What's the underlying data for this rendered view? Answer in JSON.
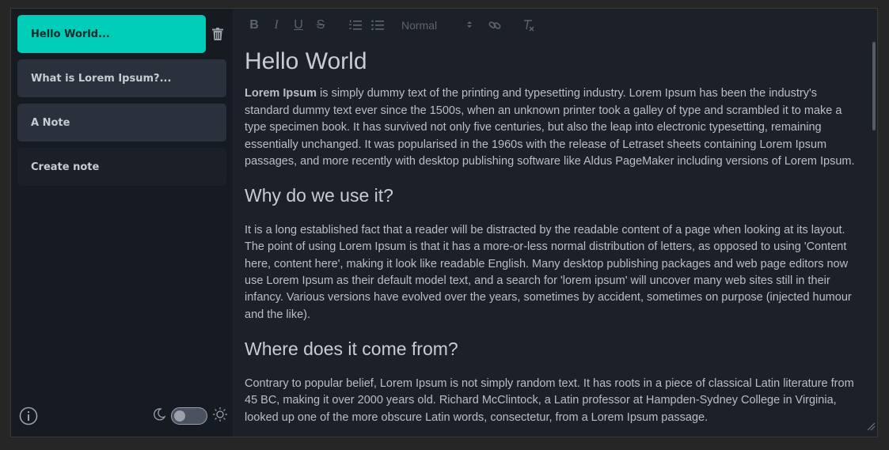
{
  "sidebar": {
    "notes": [
      {
        "label": "Hello World..."
      },
      {
        "label": "What is Lorem Ipsum?..."
      },
      {
        "label": "A Note"
      }
    ],
    "create_label": "Create note"
  },
  "toolbar": {
    "heading_value": "Normal",
    "heading_options": [
      "Normal"
    ]
  },
  "document": {
    "title": "Hello World",
    "p1_bold": "Lorem Ipsum",
    "p1_rest": " is simply dummy text of the printing and typesetting industry. Lorem Ipsum has been the industry's standard dummy text ever since the 1500s, when an unknown printer took a galley of type and scrambled it to make a type specimen book. It has survived not only five centuries, but also the leap into electronic typesetting, remaining essentially unchanged. It was popularised in the 1960s with the release of Letraset sheets containing Lorem Ipsum passages, and more recently with desktop publishing software like Aldus PageMaker including versions of Lorem Ipsum.",
    "h2_why": "Why do we use it?",
    "p_why": "It is a long established fact that a reader will be distracted by the readable content of a page when looking at its layout. The point of using Lorem Ipsum is that it has a more-or-less normal distribution of letters, as opposed to using 'Content here, content here', making it look like readable English. Many desktop publishing packages and web page editors now use Lorem Ipsum as their default model text, and a search for 'lorem ipsum' will uncover many web sites still in their infancy. Various versions have evolved over the years, sometimes by accident, sometimes on purpose (injected humour and the like).",
    "h2_where": "Where does it come from?",
    "p_where": "Contrary to popular belief, Lorem Ipsum is not simply random text. It has roots in a piece of classical Latin literature from 45 BC, making it over 2000 years old. Richard McClintock, a Latin professor at Hampden-Sydney College in Virginia, looked up one of the more obscure Latin words, consectetur, from a Lorem Ipsum passage."
  },
  "colors": {
    "accent": "#00cdb8",
    "background": "#161b22",
    "editor_background": "#1c2129"
  },
  "icons": [
    "trash-icon",
    "info-icon",
    "moon-icon",
    "sun-icon",
    "bold-icon",
    "italic-icon",
    "underline-icon",
    "strike-icon",
    "ordered-list-icon",
    "bullet-list-icon",
    "link-icon",
    "clear-format-icon"
  ]
}
